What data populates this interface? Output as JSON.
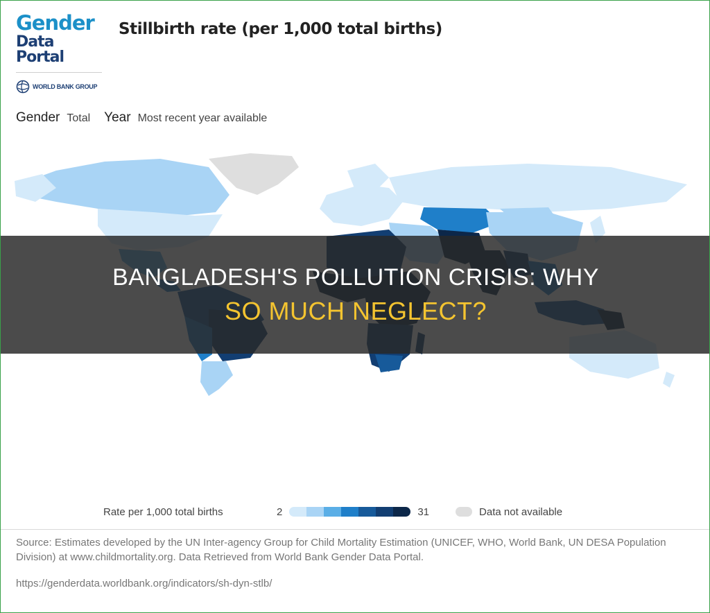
{
  "header": {
    "logo_line1": "Gender",
    "logo_line2": "Data Portal",
    "org": "WORLD BANK GROUP",
    "title": "Stillbirth rate (per 1,000 total births)"
  },
  "filters": {
    "gender_label": "Gender",
    "gender_value": "Total",
    "year_label": "Year",
    "year_value": "Most recent year available"
  },
  "banner": {
    "line1": "BANGLADESH'S POLLUTION CRISIS: WHY",
    "line2": "SO MUCH NEGLECT?"
  },
  "legend": {
    "label": "Rate per 1,000 total births",
    "min": "2",
    "max": "31",
    "na_label": "Data not available",
    "colors": [
      "#d4eafa",
      "#a9d4f5",
      "#5aaee6",
      "#1f7fc9",
      "#175a9a",
      "#123e72",
      "#0c2749"
    ]
  },
  "footer": {
    "source": "Source: Estimates developed by the UN Inter-agency Group for Child Mortality Estimation (UNICEF, WHO, World Bank, UN DESA Population Division) at www.childmortality.org. Data Retrieved from World Bank Gender Data Portal.",
    "url": "https://genderdata.worldbank.org/indicators/sh-dyn-stlb/"
  },
  "colors": {
    "border": "#3aa14a",
    "banner_text": "#ffffff",
    "banner_highlight": "#f4c430",
    "no_data": "#dedede"
  }
}
